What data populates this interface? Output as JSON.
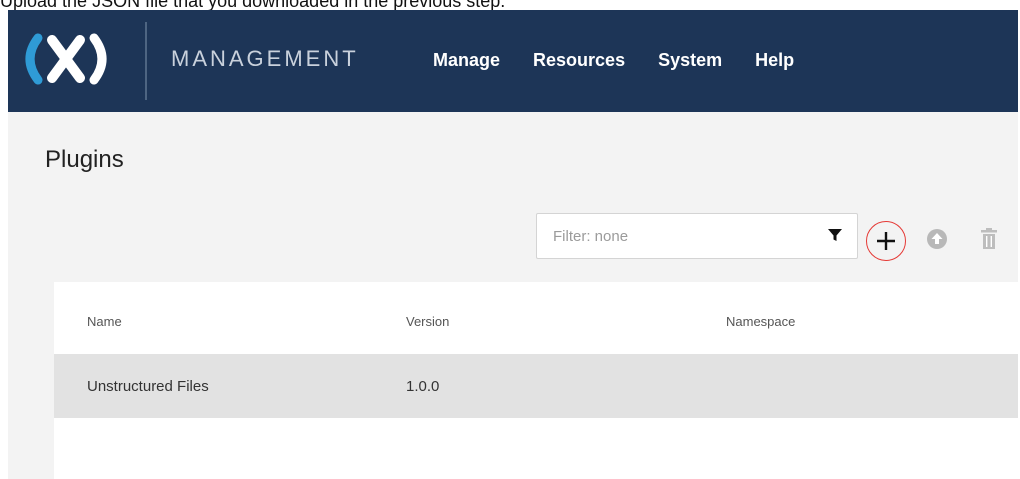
{
  "caption": "Upload the JSON file that you downloaded in the previous step.",
  "header": {
    "product_name": "MANAGEMENT",
    "nav": [
      "Manage",
      "Resources",
      "System",
      "Help"
    ],
    "logo_icon": "cdap-logo-icon",
    "background_color": "#1d3557"
  },
  "page": {
    "title": "Plugins"
  },
  "toolbar": {
    "filter_placeholder": "Filter: none",
    "filter_icon": "filter-icon",
    "add_icon": "plus-icon",
    "upload_icon": "upload-icon",
    "delete_icon": "trash-icon",
    "highlight_color": "#e53935"
  },
  "table": {
    "columns": [
      "Name",
      "Version",
      "Namespace"
    ],
    "rows": [
      {
        "name": "Unstructured Files",
        "version": "1.0.0",
        "namespace": ""
      }
    ]
  }
}
